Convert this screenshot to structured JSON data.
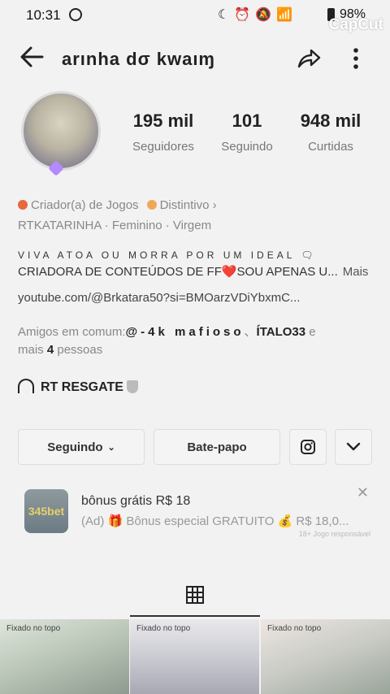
{
  "status_bar": {
    "time": "10:31",
    "battery": "98%"
  },
  "watermark": "CapCut",
  "header": {
    "username": "arınha dσ kwaıɱ"
  },
  "stats": [
    {
      "value": "195 mil",
      "label": "Seguidores"
    },
    {
      "value": "101",
      "label": "Seguindo"
    },
    {
      "value": "948 mil",
      "label": "Curtidas"
    }
  ],
  "profile": {
    "category": "Criador(a) de Jogos",
    "badge": "Distintivo",
    "meta": "RTKATARINHA · Feminino · Virgem",
    "bio_line1": "VIVA ATOA OU MORRA POR UM IDEAL 🗨",
    "bio_line2": "CRIADORA DE CONTEÚDOS DE FF❤️SOU APENAS U...",
    "bio_more": "Mais",
    "link": "youtube.com/@Brkatara50?si=BMOarzVDiYbxmC..."
  },
  "friends": {
    "prefix": "Amigos em comum:",
    "friend1": "@-4k mafioso",
    "sep": "、",
    "friend2": "ÍTALO33",
    "suffix1": " e",
    "line2_prefix": "mais ",
    "count": "4",
    "line2_suffix": " pessoas"
  },
  "group": {
    "name": "RT RESGATE"
  },
  "actions": {
    "following": "Seguindo",
    "chat": "Bate-papo"
  },
  "ad": {
    "logo_text": "345bet",
    "title": "bônus grátis R$ 18",
    "subtitle": "(Ad) 🎁 Bônus especial GRATUITO 💰 R$ 18,0...",
    "tag": "18+ Jogo responsável"
  },
  "videos": [
    {
      "pin": "Fixado no topo"
    },
    {
      "pin": "Fixado no topo"
    },
    {
      "pin": "Fixado no topo"
    }
  ]
}
